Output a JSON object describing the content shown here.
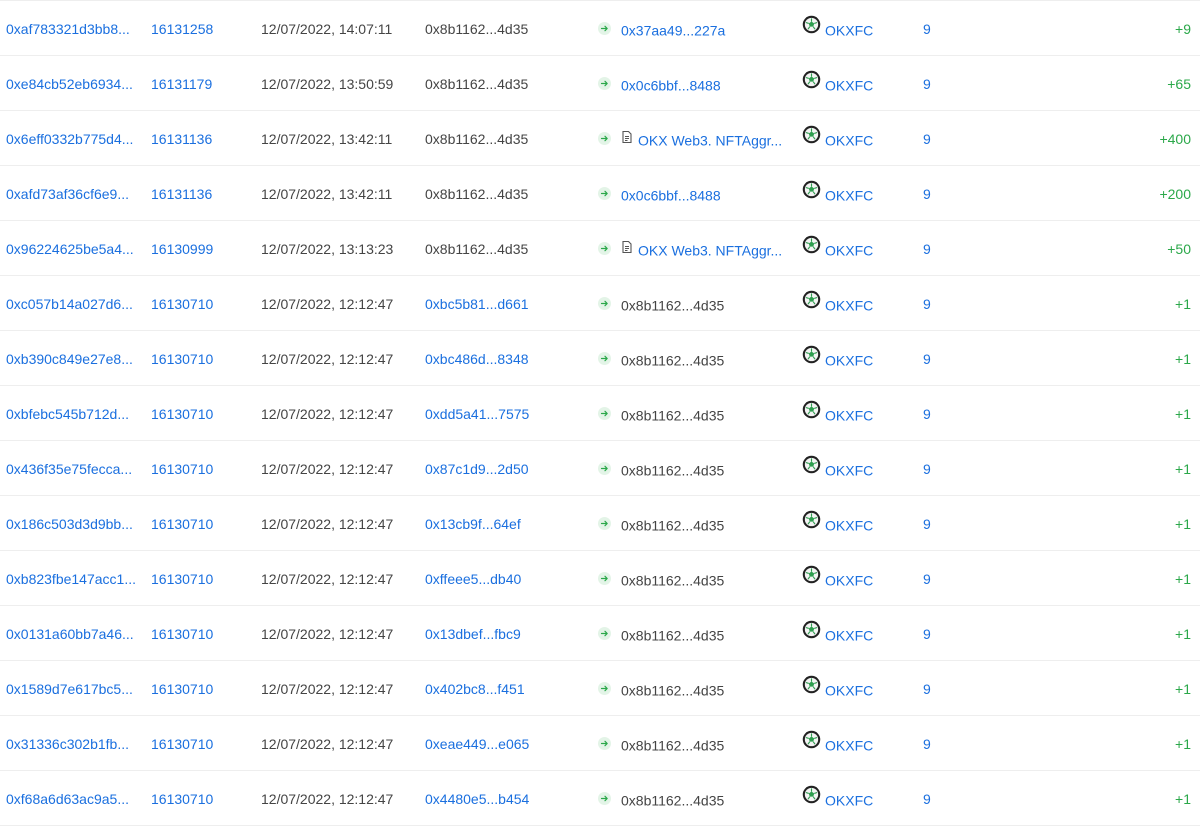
{
  "rows": [
    {
      "hash": "0xaf783321d3bb8...",
      "block": "16131258",
      "time": "12/07/2022, 14:07:11",
      "from": "0x8b1162...4d35",
      "from_link": false,
      "to": "0x37aa49...227a",
      "to_link": true,
      "to_contract": false,
      "token": "OKXFC",
      "decimals": "9",
      "amount": "+9"
    },
    {
      "hash": "0xe84cb52eb6934...",
      "block": "16131179",
      "time": "12/07/2022, 13:50:59",
      "from": "0x8b1162...4d35",
      "from_link": false,
      "to": "0x0c6bbf...8488",
      "to_link": true,
      "to_contract": false,
      "token": "OKXFC",
      "decimals": "9",
      "amount": "+65"
    },
    {
      "hash": "0x6eff0332b775d4...",
      "block": "16131136",
      "time": "12/07/2022, 13:42:11",
      "from": "0x8b1162...4d35",
      "from_link": false,
      "to": "OKX Web3. NFTAggr...",
      "to_link": true,
      "to_contract": true,
      "token": "OKXFC",
      "decimals": "9",
      "amount": "+400"
    },
    {
      "hash": "0xafd73af36cf6e9...",
      "block": "16131136",
      "time": "12/07/2022, 13:42:11",
      "from": "0x8b1162...4d35",
      "from_link": false,
      "to": "0x0c6bbf...8488",
      "to_link": true,
      "to_contract": false,
      "token": "OKXFC",
      "decimals": "9",
      "amount": "+200"
    },
    {
      "hash": "0x96224625be5a4...",
      "block": "16130999",
      "time": "12/07/2022, 13:13:23",
      "from": "0x8b1162...4d35",
      "from_link": false,
      "to": "OKX Web3. NFTAggr...",
      "to_link": true,
      "to_contract": true,
      "token": "OKXFC",
      "decimals": "9",
      "amount": "+50"
    },
    {
      "hash": "0xc057b14a027d6...",
      "block": "16130710",
      "time": "12/07/2022, 12:12:47",
      "from": "0xbc5b81...d661",
      "from_link": true,
      "to": "0x8b1162...4d35",
      "to_link": false,
      "to_contract": false,
      "token": "OKXFC",
      "decimals": "9",
      "amount": "+1"
    },
    {
      "hash": "0xb390c849e27e8...",
      "block": "16130710",
      "time": "12/07/2022, 12:12:47",
      "from": "0xbc486d...8348",
      "from_link": true,
      "to": "0x8b1162...4d35",
      "to_link": false,
      "to_contract": false,
      "token": "OKXFC",
      "decimals": "9",
      "amount": "+1"
    },
    {
      "hash": "0xbfebc545b712d...",
      "block": "16130710",
      "time": "12/07/2022, 12:12:47",
      "from": "0xdd5a41...7575",
      "from_link": true,
      "to": "0x8b1162...4d35",
      "to_link": false,
      "to_contract": false,
      "token": "OKXFC",
      "decimals": "9",
      "amount": "+1"
    },
    {
      "hash": "0x436f35e75fecca...",
      "block": "16130710",
      "time": "12/07/2022, 12:12:47",
      "from": "0x87c1d9...2d50",
      "from_link": true,
      "to": "0x8b1162...4d35",
      "to_link": false,
      "to_contract": false,
      "token": "OKXFC",
      "decimals": "9",
      "amount": "+1"
    },
    {
      "hash": "0x186c503d3d9bb...",
      "block": "16130710",
      "time": "12/07/2022, 12:12:47",
      "from": "0x13cb9f...64ef",
      "from_link": true,
      "to": "0x8b1162...4d35",
      "to_link": false,
      "to_contract": false,
      "token": "OKXFC",
      "decimals": "9",
      "amount": "+1"
    },
    {
      "hash": "0xb823fbe147acc1...",
      "block": "16130710",
      "time": "12/07/2022, 12:12:47",
      "from": "0xffeee5...db40",
      "from_link": true,
      "to": "0x8b1162...4d35",
      "to_link": false,
      "to_contract": false,
      "token": "OKXFC",
      "decimals": "9",
      "amount": "+1"
    },
    {
      "hash": "0x0131a60bb7a46...",
      "block": "16130710",
      "time": "12/07/2022, 12:12:47",
      "from": "0x13dbef...fbc9",
      "from_link": true,
      "to": "0x8b1162...4d35",
      "to_link": false,
      "to_contract": false,
      "token": "OKXFC",
      "decimals": "9",
      "amount": "+1"
    },
    {
      "hash": "0x1589d7e617bc5...",
      "block": "16130710",
      "time": "12/07/2022, 12:12:47",
      "from": "0x402bc8...f451",
      "from_link": true,
      "to": "0x8b1162...4d35",
      "to_link": false,
      "to_contract": false,
      "token": "OKXFC",
      "decimals": "9",
      "amount": "+1"
    },
    {
      "hash": "0x31336c302b1fb...",
      "block": "16130710",
      "time": "12/07/2022, 12:12:47",
      "from": "0xeae449...e065",
      "from_link": true,
      "to": "0x8b1162...4d35",
      "to_link": false,
      "to_contract": false,
      "token": "OKXFC",
      "decimals": "9",
      "amount": "+1"
    },
    {
      "hash": "0xf68a6d63ac9a5...",
      "block": "16130710",
      "time": "12/07/2022, 12:12:47",
      "from": "0x4480e5...b454",
      "from_link": true,
      "to": "0x8b1162...4d35",
      "to_link": false,
      "to_contract": false,
      "token": "OKXFC",
      "decimals": "9",
      "amount": "+1"
    }
  ],
  "icons": {
    "direction": "arrow-right-icon",
    "contract": "contract-file-icon",
    "token": "soccer-ball-icon"
  },
  "colors": {
    "link": "#1a6fdf",
    "amount_positive": "#2ba84a",
    "arrow_badge_bg": "#e3f4e7",
    "divider": "#eeeeee"
  }
}
